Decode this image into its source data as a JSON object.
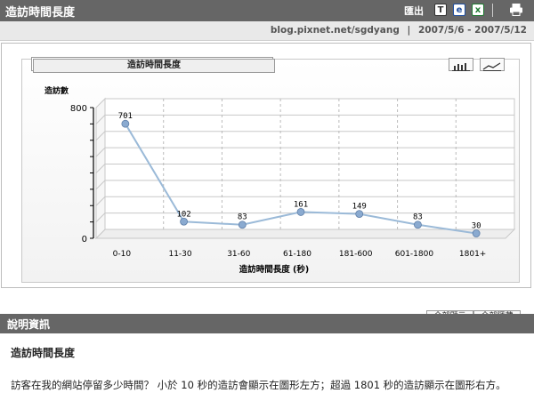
{
  "header": {
    "title": "造訪時間長度",
    "export_label": "匯出",
    "icons": [
      "text-export-icon",
      "web-export-icon",
      "excel-export-icon",
      "print-icon"
    ]
  },
  "subheader": {
    "site": "blog.pixnet.net/sgdyang",
    "separator": "|",
    "date_range": "2007/5/6 - 2007/5/12"
  },
  "chart_panel": {
    "tab_label": "造訪時間長度",
    "view_buttons": [
      "bar-chart-icon",
      "line-chart-icon"
    ],
    "show_all_label": "全部顯示",
    "hide_all_label": "全部隱藏"
  },
  "chart_data": {
    "type": "line",
    "categories": [
      "0-10",
      "11-30",
      "31-60",
      "61-180",
      "181-600",
      "601-1800",
      "1801+"
    ],
    "series": [
      {
        "values": [
          701,
          102,
          83,
          161,
          149,
          83,
          30
        ]
      }
    ],
    "data_labels": [
      "701",
      "102",
      "83",
      "161",
      "149",
      "83",
      "30"
    ],
    "ylabel": "造訪數",
    "xlabel": "造訪時間長度 (秒)",
    "ylim": [
      0,
      800
    ],
    "y_ticks": [
      "0",
      "800"
    ],
    "grid": true,
    "colors": {
      "line": "#9bbad8",
      "marker": "#8aaad0",
      "grid": "#c8c8c8"
    }
  },
  "info": {
    "section_title": "說明資訊",
    "heading": "造訪時間長度",
    "text": "訪客在我的網站停留多少時間？ 小於 10 秒的造訪會顯示在圖形左方；超過 1801 秒的造訪顯示在圖形右方。"
  }
}
